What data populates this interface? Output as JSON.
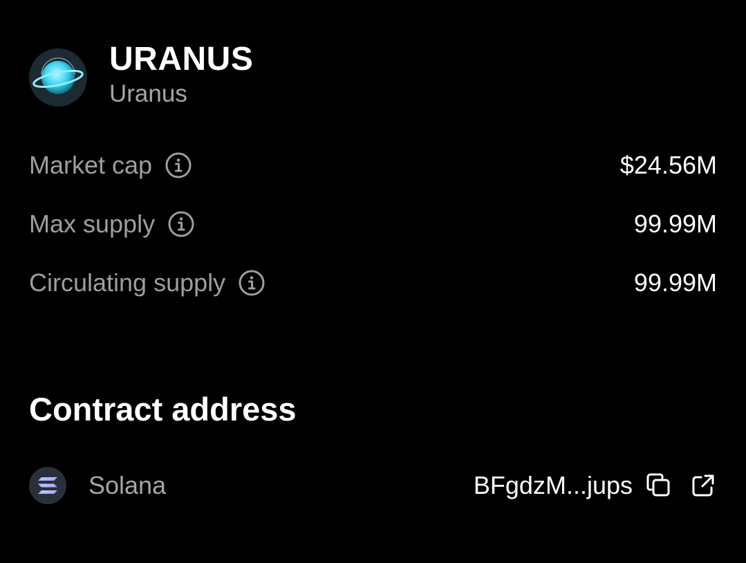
{
  "token": {
    "symbol": "URANUS",
    "name": "Uranus",
    "logo_icon": "uranus-planet-logo"
  },
  "stats": [
    {
      "label": "Market cap",
      "value": "$24.56M",
      "icon": "info-icon"
    },
    {
      "label": "Max supply",
      "value": "99.99M",
      "icon": "info-icon"
    },
    {
      "label": "Circulating supply",
      "value": "99.99M",
      "icon": "info-icon"
    }
  ],
  "contract": {
    "title": "Contract address",
    "chain": "Solana",
    "chain_icon": "solana-logo",
    "address": "BFgdzM...jups",
    "copy_icon": "copy-icon",
    "external_icon": "external-link-icon"
  },
  "colors": {
    "background": "#000000",
    "primary_text": "#ffffff",
    "secondary_text": "#9e9e9e",
    "planet_accent": "#3fd6f0"
  }
}
